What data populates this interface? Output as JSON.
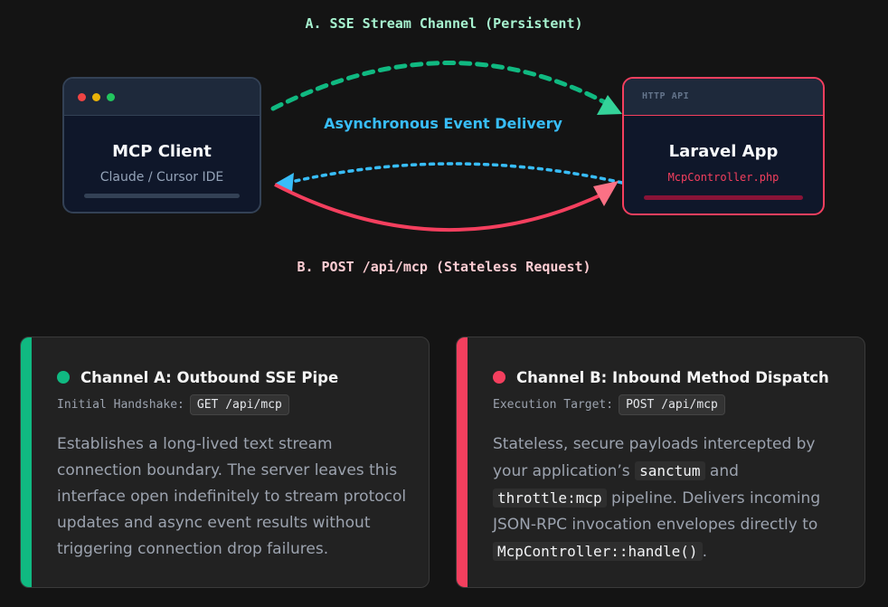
{
  "diagram": {
    "label_a": "A. SSE Stream Channel (Persistent)",
    "label_b": "B. POST /api/mcp (Stateless Request)",
    "label_async": "Asynchronous Event Delivery",
    "client": {
      "title": "MCP Client",
      "subtitle": "Claude / Cursor IDE"
    },
    "server": {
      "header": "HTTP API",
      "title": "Laravel App",
      "subtitle": "McpController.php"
    },
    "colors": {
      "sse": "#10b981",
      "post": "#f43f5e",
      "async": "#38bdf8"
    }
  },
  "cards": {
    "a": {
      "title": "Channel A: Outbound SSE Pipe",
      "meta_label": "Initial Handshake:",
      "meta_value": "GET /api/mcp",
      "description": "Establishes a long-lived text stream connection boundary. The server leaves this interface open indefinitely to stream protocol updates and async event results without triggering connection drop failures."
    },
    "b": {
      "title": "Channel B: Inbound Method Dispatch",
      "meta_label": "Execution Target:",
      "meta_value": "POST /api/mcp",
      "desc_1": "Stateless, secure payloads intercepted by your application’s",
      "code_1": "sanctum",
      "desc_2": "and",
      "code_2": "throttle:mcp",
      "desc_3": "pipeline. Delivers incoming JSON-RPC invocation envelopes directly to",
      "code_3": "McpController::handle()",
      "desc_4": "."
    }
  }
}
